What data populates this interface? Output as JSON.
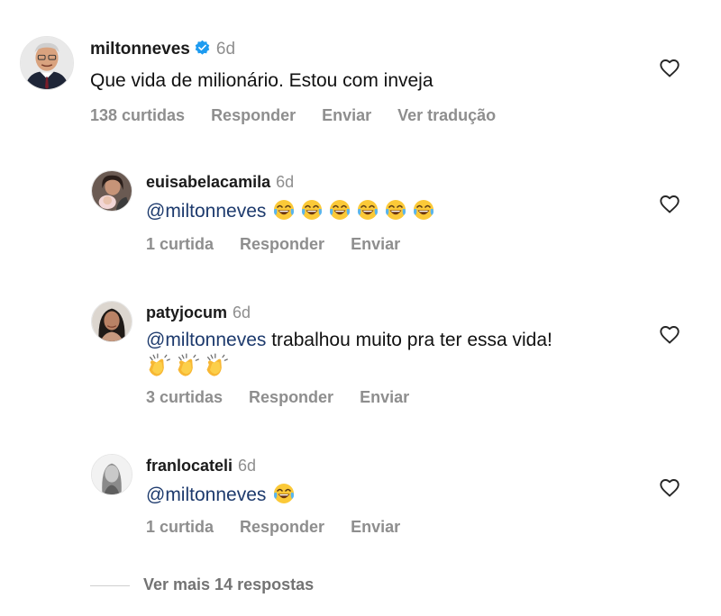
{
  "comments": [
    {
      "username": "miltonneves",
      "verified": true,
      "time": "6d",
      "text": "Que vida de milionário. Estou com inveja",
      "likes": "138 curtidas",
      "reply_label": "Responder",
      "send_label": "Enviar",
      "translate_label": "Ver tradução"
    },
    {
      "username": "euisabelacamila",
      "time": "6d",
      "mention": "@miltonneves",
      "emoji": [
        "joy-emoji",
        "joy-emoji",
        "joy-emoji",
        "joy-emoji",
        "joy-emoji",
        "joy-emoji"
      ],
      "likes": "1 curtida",
      "reply_label": "Responder",
      "send_label": "Enviar"
    },
    {
      "username": "patyjocum",
      "time": "6d",
      "mention": "@miltonneves",
      "text": " trabalhou muito pra ter essa vida!",
      "emoji": [
        "clapping-hands-emoji",
        "clapping-hands-emoji",
        "clapping-hands-emoji"
      ],
      "likes": "3 curtidas",
      "reply_label": "Responder",
      "send_label": "Enviar"
    },
    {
      "username": "franlocateli",
      "time": "6d",
      "mention": "@miltonneves",
      "emoji": [
        "joy-emoji"
      ],
      "likes": "1 curtida",
      "reply_label": "Responder",
      "send_label": "Enviar"
    }
  ],
  "view_more": "Ver mais 14 respostas",
  "icons": {
    "like": "heart-outline-icon",
    "verified": "verified-badge-icon"
  },
  "colors": {
    "mention": "#1d3a6d",
    "meta": "#8e8e8e",
    "verified": "#1d9bf0"
  }
}
